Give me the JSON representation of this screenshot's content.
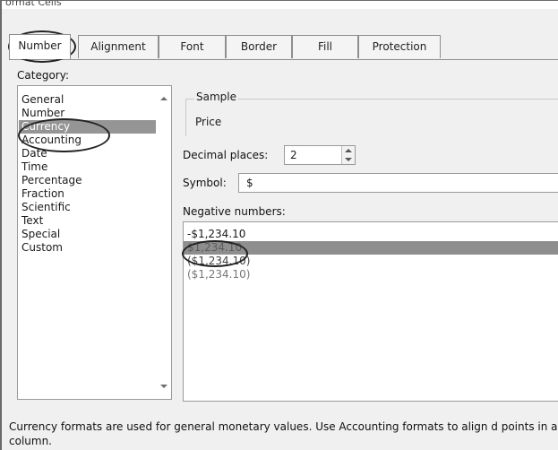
{
  "window": {
    "title": "ormat Cells"
  },
  "tabs": [
    {
      "label": "Number"
    },
    {
      "label": "Alignment"
    },
    {
      "label": "Font"
    },
    {
      "label": "Border"
    },
    {
      "label": "Fill"
    },
    {
      "label": "Protection"
    }
  ],
  "category": {
    "label": "Category:",
    "items": [
      "General",
      "Number",
      "Currency",
      "Accounting",
      "Date",
      "Time",
      "Percentage",
      "Fraction",
      "Scientific",
      "Text",
      "Special",
      "Custom"
    ],
    "selected": "Currency"
  },
  "sample": {
    "legend": "Sample",
    "value": "Price"
  },
  "decimal_places": {
    "label": "Decimal places:",
    "value": "2"
  },
  "symbol": {
    "label": "Symbol:",
    "value": "$"
  },
  "negative_numbers": {
    "label": "Negative numbers:",
    "items": [
      "-$1,234.10",
      "$1,234.10",
      "($1,234.10)",
      "($1,234.10)"
    ],
    "selected_index": 1
  },
  "description": "Currency formats are used for general monetary values.  Use Accounting formats to align d points in a column.",
  "colors": {
    "selection": "#959595",
    "negative_red": "#c00000"
  }
}
